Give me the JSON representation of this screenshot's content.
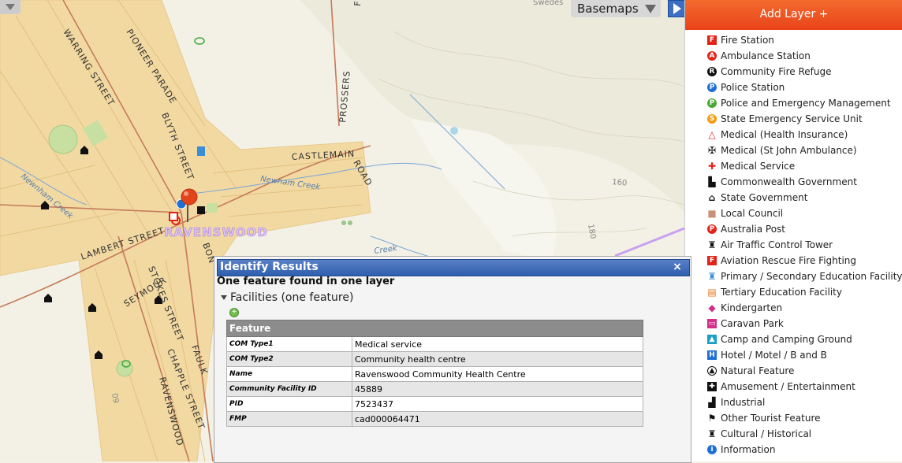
{
  "map": {
    "streets": [
      "WARRING STREET",
      "PIONEER PARADE",
      "BLYTH STREET",
      "FOREST ROAD",
      "PROSSERS",
      "CASTLEMAIN",
      "ROAD",
      "LAMBERT STREET",
      "STOKES STREET",
      "SEYMOUR",
      "CHAPPLE STREET",
      "RAVENSWOOD",
      "FAULK",
      "BON"
    ],
    "creeks": [
      "Newnham Creek",
      "Newham Creek",
      "Creek"
    ],
    "town": "RAVENSWOOD",
    "place_top": "Swedes",
    "contours": [
      "160",
      "180",
      "09"
    ],
    "basemaps_label": "Basemaps"
  },
  "panel": {
    "add_layer_label": "Add Layer +",
    "layers": [
      {
        "label": "Fire Station",
        "icon": "fire-station-icon",
        "color": "#e2231a",
        "glyph": "F",
        "shape": "square"
      },
      {
        "label": "Ambulance Station",
        "icon": "ambulance-station-icon",
        "color": "#e2231a",
        "glyph": "A",
        "shape": "circle"
      },
      {
        "label": "Community Fire Refuge",
        "icon": "fire-refuge-icon",
        "color": "#111111",
        "glyph": "R",
        "shape": "circle"
      },
      {
        "label": "Police Station",
        "icon": "police-station-icon",
        "color": "#1f6fd6",
        "glyph": "P",
        "shape": "circle"
      },
      {
        "label": "Police and Emergency Management",
        "icon": "emergency-management-icon",
        "color": "#4aa833",
        "glyph": "P",
        "shape": "circle"
      },
      {
        "label": "State Emergency Service Unit",
        "icon": "ses-unit-icon",
        "color": "#f39c12",
        "glyph": "S",
        "shape": "circle"
      },
      {
        "label": "Medical (Health Insurance)",
        "icon": "health-insurance-icon",
        "color": "#e2231a",
        "glyph": "△",
        "shape": "plain"
      },
      {
        "label": "Medical (St John Ambulance)",
        "icon": "st-john-icon",
        "color": "#111111",
        "glyph": "✠",
        "shape": "plain"
      },
      {
        "label": "Medical Service",
        "icon": "medical-cross-icon",
        "color": "#e2231a",
        "glyph": "✚",
        "shape": "plain"
      },
      {
        "label": "Commonwealth Government",
        "icon": "commonwealth-govt-icon",
        "color": "#111111",
        "glyph": "▙",
        "shape": "plain"
      },
      {
        "label": "State Government",
        "icon": "state-govt-icon",
        "color": "#111111",
        "glyph": "⌂",
        "shape": "plain"
      },
      {
        "label": "Local Council",
        "icon": "local-council-icon",
        "color": "#c9917a",
        "glyph": "■",
        "shape": "plain"
      },
      {
        "label": "Australia Post",
        "icon": "australia-post-icon",
        "color": "#e2231a",
        "glyph": "P",
        "shape": "circle"
      },
      {
        "label": "Air Traffic Control Tower",
        "icon": "control-tower-icon",
        "color": "#111111",
        "glyph": "♜",
        "shape": "plain"
      },
      {
        "label": "Aviation Rescue Fire Fighting",
        "icon": "aviation-rescue-icon",
        "color": "#e2231a",
        "glyph": "F",
        "shape": "square"
      },
      {
        "label": "Primary / Secondary Education Facility",
        "icon": "school-icon",
        "color": "#3a8dd6",
        "glyph": "♜",
        "shape": "plain"
      },
      {
        "label": "Tertiary Education Facility",
        "icon": "tertiary-education-icon",
        "color": "#e8731b",
        "glyph": "▤",
        "shape": "plain"
      },
      {
        "label": "Kindergarten",
        "icon": "kindergarten-icon",
        "color": "#d12f8a",
        "glyph": "◆",
        "shape": "plain"
      },
      {
        "label": "Caravan Park",
        "icon": "caravan-park-icon",
        "color": "#d12f8a",
        "glyph": "▭",
        "shape": "square"
      },
      {
        "label": "Camp and Camping Ground",
        "icon": "camping-icon",
        "color": "#1ba0c4",
        "glyph": "▲",
        "shape": "square"
      },
      {
        "label": "Hotel / Motel / B and B",
        "icon": "hotel-icon",
        "color": "#1f6fd6",
        "glyph": "H",
        "shape": "square"
      },
      {
        "label": "Natural Feature",
        "icon": "natural-feature-icon",
        "color": "#111111",
        "glyph": "▲",
        "shape": "circle-outline"
      },
      {
        "label": "Amusement / Entertainment",
        "icon": "amusement-icon",
        "color": "#111111",
        "glyph": "✚",
        "shape": "square"
      },
      {
        "label": "Industrial",
        "icon": "industrial-icon",
        "color": "#111111",
        "glyph": "▟",
        "shape": "plain"
      },
      {
        "label": "Other Tourist Feature",
        "icon": "tourist-feature-icon",
        "color": "#111111",
        "glyph": "⚑",
        "shape": "plain"
      },
      {
        "label": "Cultural / Historical",
        "icon": "cultural-historical-icon",
        "color": "#111111",
        "glyph": "♜",
        "shape": "plain"
      },
      {
        "label": "Information",
        "icon": "information-icon",
        "color": "#1f6fd6",
        "glyph": "i",
        "shape": "circle"
      }
    ]
  },
  "identify": {
    "title": "Identify Results",
    "close": "×",
    "summary": "One feature found in one layer",
    "layer_group": "Facilities (one feature)",
    "zoom_glyph": "+",
    "table_header": "Feature",
    "rows": [
      {
        "key": "COM Type1",
        "value": "Medical service"
      },
      {
        "key": "COM Type2",
        "value": "Community health centre"
      },
      {
        "key": "Name",
        "value": "Ravenswood Community Health Centre"
      },
      {
        "key": "Community Facility ID",
        "value": "45889"
      },
      {
        "key": "PID",
        "value": "7523437"
      },
      {
        "key": "FMP",
        "value": "cad000064471"
      }
    ]
  },
  "colors": {
    "accent_orange": "#e8431b",
    "identify_blue": "#2f5fae",
    "urban_fill": "#f2d9a2",
    "road_brown": "#c47b5a"
  }
}
